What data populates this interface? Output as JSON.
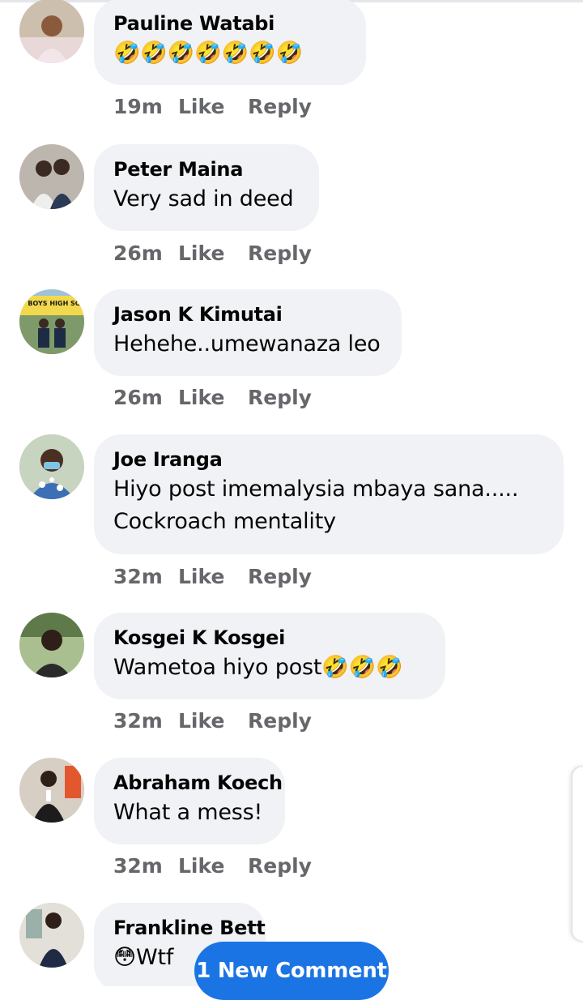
{
  "actions": {
    "like": "Like",
    "reply": "Reply"
  },
  "comments": [
    {
      "author": "Pauline Watabi",
      "text": "",
      "emoji": "🤣🤣🤣🤣🤣🤣🤣",
      "time": "19m"
    },
    {
      "author": "Peter Maina",
      "text": "Very sad in deed",
      "emoji": "",
      "time": "26m"
    },
    {
      "author": "Jason K Kimutai",
      "text": "Hehehe..umewanaza leo",
      "emoji": "",
      "time": "26m"
    },
    {
      "author": "Joe Iranga",
      "text": "Hiyo post imemalysia mbaya sana.....",
      "text2": "Cockroach mentality",
      "emoji": "",
      "time": "32m"
    },
    {
      "author": "Kosgei K Kosgei",
      "text": "Wametoa hiyo post",
      "emoji": "🤣🤣🤣",
      "time": "32m"
    },
    {
      "author": "Abraham Koech",
      "text": "What a mess!",
      "emoji": "",
      "time": "32m"
    },
    {
      "author": "Frankline Bett",
      "text": "Wtf",
      "emoji": "😳",
      "time": ""
    }
  ],
  "avatar_school_sign": "YEMIT BOYS HIGH SCHOOL",
  "new_comment_label": "1 New Comment",
  "colors": {
    "bubble": "#f0f2f5",
    "meta": "#65676b",
    "accent": "#1b74e4"
  }
}
